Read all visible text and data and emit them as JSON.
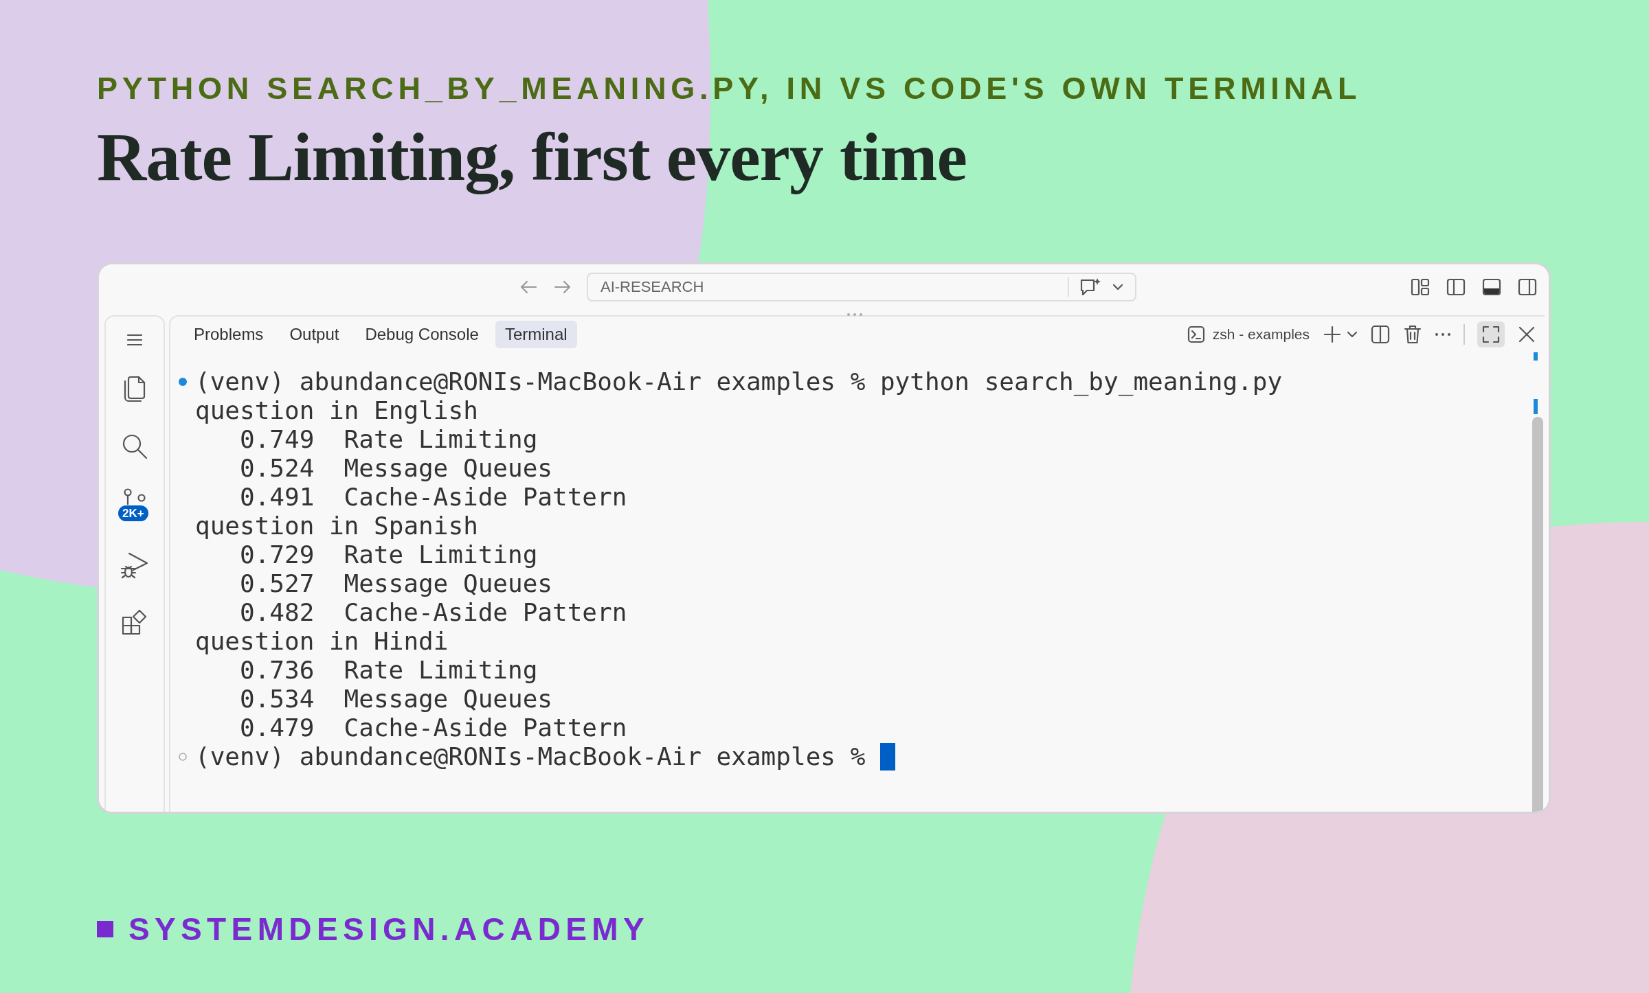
{
  "header": {
    "kicker": "PYTHON SEARCH_BY_MEANING.PY, IN VS CODE'S OWN TERMINAL",
    "title": "Rate Limiting, first every time"
  },
  "window": {
    "command_center": {
      "label": "AI-RESEARCH"
    },
    "activity_bar": {
      "badge": "2K+"
    },
    "panel": {
      "tabs": [
        {
          "label": "Problems",
          "selected": false
        },
        {
          "label": "Output",
          "selected": false
        },
        {
          "label": "Debug Console",
          "selected": false
        },
        {
          "label": "Terminal",
          "selected": true
        }
      ],
      "terminal_name": "zsh - examples",
      "maximized": true,
      "terminal": {
        "lines": [
          {
            "kind": "command",
            "success": true,
            "prompt": "(venv) abundance@RONIs-MacBook-Air examples %",
            "command": "python search_by_meaning.py",
            "cursor": false
          },
          {
            "kind": "heading",
            "text": "question in English"
          },
          {
            "kind": "result",
            "score": "0.749",
            "label": "Rate Limiting"
          },
          {
            "kind": "result",
            "score": "0.524",
            "label": "Message Queues"
          },
          {
            "kind": "result",
            "score": "0.491",
            "label": "Cache-Aside Pattern"
          },
          {
            "kind": "heading",
            "text": "question in Spanish"
          },
          {
            "kind": "result",
            "score": "0.729",
            "label": "Rate Limiting"
          },
          {
            "kind": "result",
            "score": "0.527",
            "label": "Message Queues"
          },
          {
            "kind": "result",
            "score": "0.482",
            "label": "Cache-Aside Pattern"
          },
          {
            "kind": "heading",
            "text": "question in Hindi"
          },
          {
            "kind": "result",
            "score": "0.736",
            "label": "Rate Limiting"
          },
          {
            "kind": "result",
            "score": "0.534",
            "label": "Message Queues"
          },
          {
            "kind": "result",
            "score": "0.479",
            "label": "Cache-Aside Pattern"
          },
          {
            "kind": "command",
            "success": false,
            "prompt": "(venv) abundance@RONIs-MacBook-Air examples %",
            "cursor": true
          }
        ]
      }
    }
  },
  "footer": {
    "brand": "SYSTEMDESIGN.ACADEMY"
  }
}
